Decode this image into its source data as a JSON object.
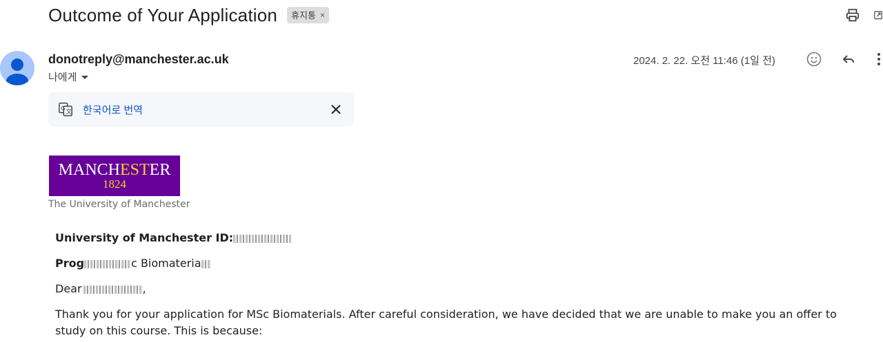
{
  "subject": {
    "title": "Outcome of Your Application",
    "label": "휴지통",
    "label_remove": "×"
  },
  "sender": {
    "email": "donotreply@manchester.ac.uk",
    "recipient": "나에게",
    "date": "2024. 2. 22. 오전 11:46 (1일 전)"
  },
  "translate": {
    "link": "한국어로 번역"
  },
  "logo": {
    "word_part1": "MANCH",
    "word_part2": "EST",
    "word_part3": "ER",
    "year": "1824",
    "subtitle": "The University of Manchester"
  },
  "email_body": {
    "id_label": "University of Manchester ID:",
    "programme_prefix": "Prog",
    "programme_mid": "c Biomateria",
    "dear_prefix": "Dear",
    "dear_suffix": ",",
    "paragraph": "Thank you for your application for MSc Biomaterials. After careful consideration, we have decided that we are unable to make you an offer to study on this course.  This is because:"
  },
  "icons": {
    "print": "print-icon",
    "open_new": "open-in-new-window-icon",
    "emoji": "emoji-reaction-icon",
    "reply": "reply-icon",
    "more": "more-vert-icon",
    "translate": "translate-icon",
    "close": "close-icon",
    "dropdown": "dropdown-arrow-icon",
    "avatar": "default-avatar-icon"
  },
  "colors": {
    "manchester_purple": "#660099",
    "manchester_gold": "#ffcc33",
    "link_blue": "#0b57d0",
    "avatar_bg": "#a8c7fa"
  }
}
